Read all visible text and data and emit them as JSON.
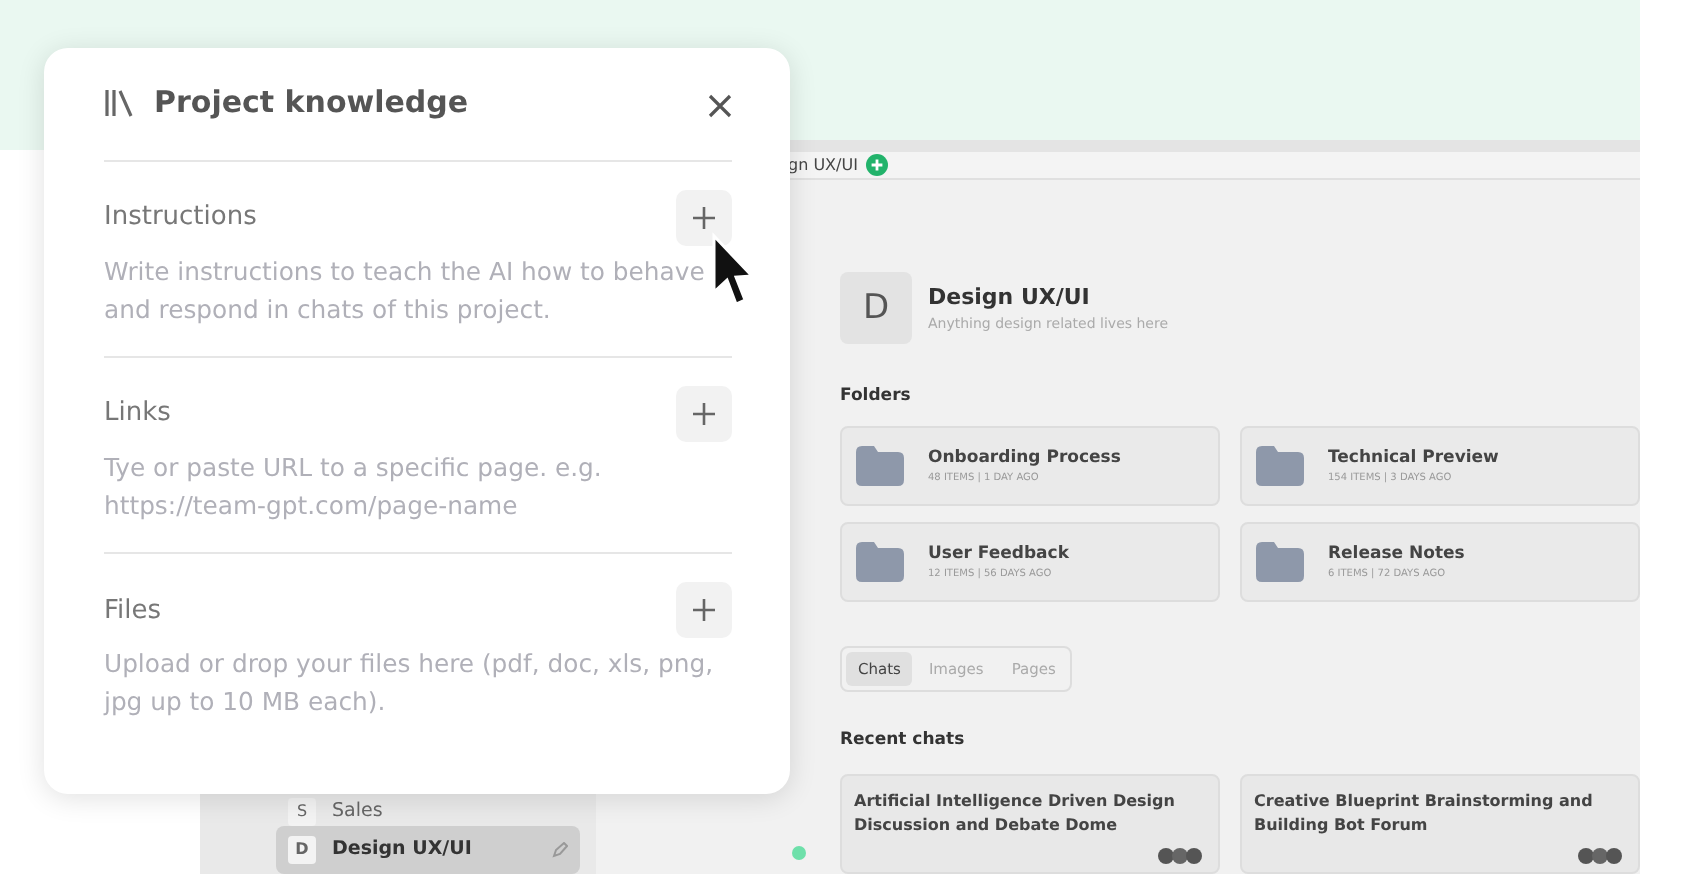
{
  "modal": {
    "title": "Project knowledge",
    "sections": [
      {
        "label": "Instructions",
        "description": "Write instructions to teach the AI how to behave and respond in chats of this project."
      },
      {
        "label": "Links",
        "description": "Tye or paste URL to a specific page. e.g. https://team-gpt.com/page-name"
      },
      {
        "label": "Files",
        "description": "Upload or drop your files here (pdf, doc, xls, png, jpg up to 10 MB each)."
      }
    ]
  },
  "app": {
    "tab": "gn UX/UI",
    "sidebar": {
      "items": [
        {
          "initial": "S",
          "label": "Sales",
          "selected": false
        },
        {
          "initial": "D",
          "label": "Design UX/UI",
          "selected": true
        }
      ]
    },
    "project": {
      "initial": "D",
      "name": "Design UX/UI",
      "description": "Anything design related lives here"
    },
    "folders_heading": "Folders",
    "folders": [
      {
        "name": "Onboarding Process",
        "meta": "48 ITEMS | 1 DAY AGO"
      },
      {
        "name": "Technical Preview",
        "meta": "154 ITEMS | 3 DAYS AGO"
      },
      {
        "name": "User Feedback",
        "meta": "12 ITEMS | 56 DAYS AGO"
      },
      {
        "name": "Release Notes",
        "meta": "6 ITEMS | 72 DAYS AGO"
      }
    ],
    "view_tabs": [
      {
        "label": "Chats",
        "selected": true
      },
      {
        "label": "Images",
        "selected": false
      },
      {
        "label": "Pages",
        "selected": false
      }
    ],
    "recent_heading": "Recent chats",
    "chats": [
      {
        "title": "Artificial Intelligence Driven Design Discussion and Debate Dome"
      },
      {
        "title": "Creative Blueprint Brainstorming and Building Bot Forum"
      }
    ]
  }
}
